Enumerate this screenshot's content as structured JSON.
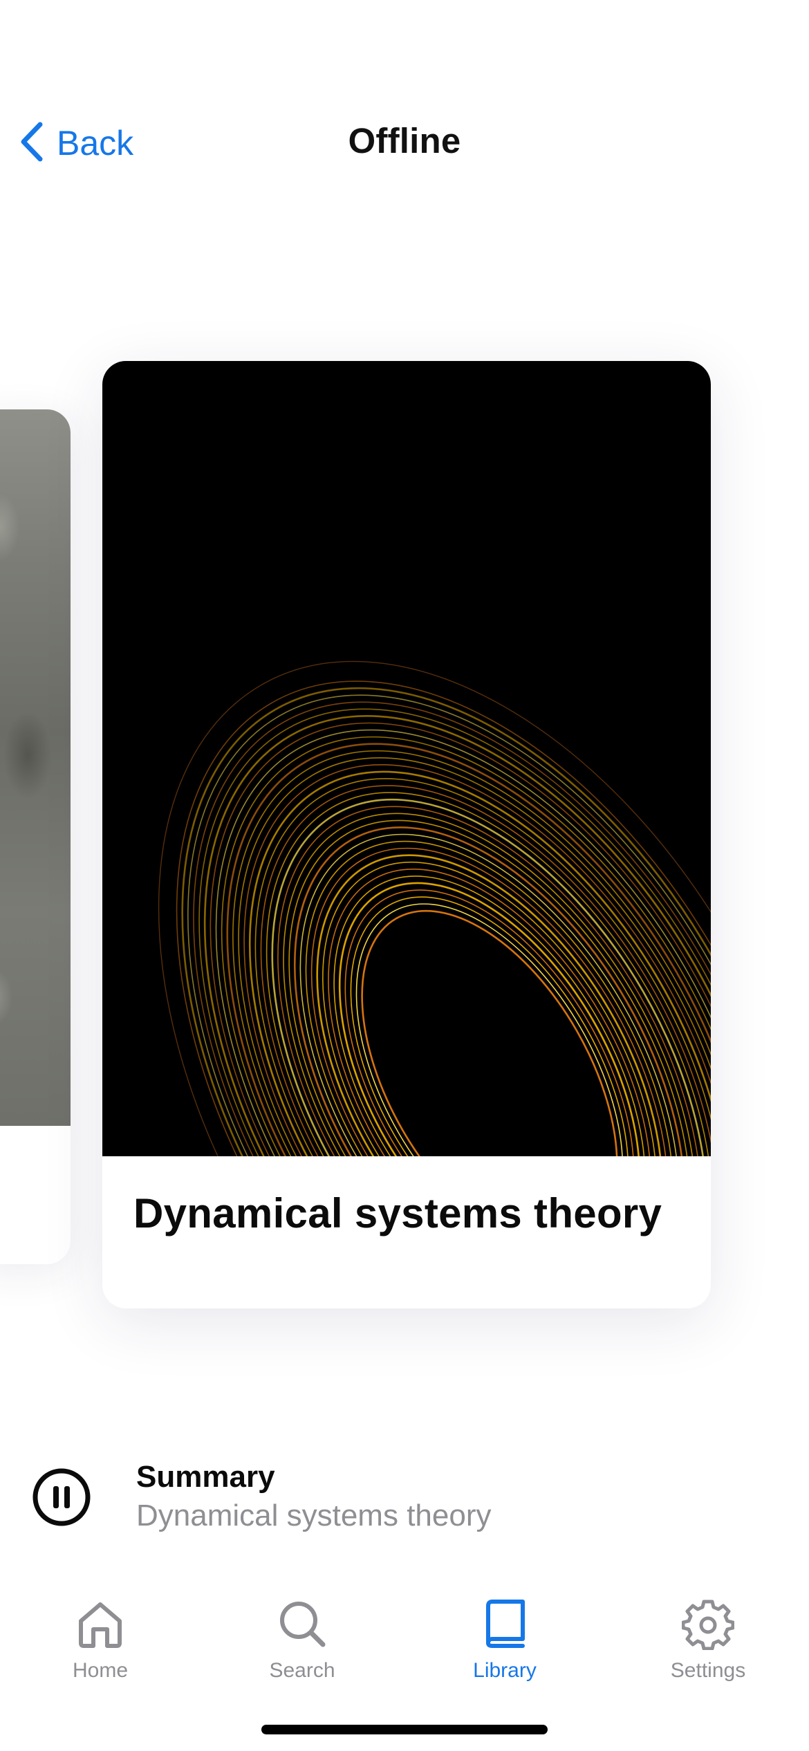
{
  "header": {
    "back_label": "Back",
    "title": "Offline"
  },
  "carousel": {
    "main_card": {
      "title": "Dynamical systems theory",
      "cover_icon": "orbit-trajectories-artwork"
    },
    "side_card": {
      "cover_icon": "grayscale-photo"
    }
  },
  "player": {
    "state": "playing",
    "title": "Summary",
    "subtitle": "Dynamical systems theory",
    "icon": "pause-icon"
  },
  "tabs": [
    {
      "label": "Home",
      "icon": "home-icon",
      "active": false
    },
    {
      "label": "Search",
      "icon": "search-icon",
      "active": false
    },
    {
      "label": "Library",
      "icon": "book-icon",
      "active": true
    },
    {
      "label": "Settings",
      "icon": "gear-icon",
      "active": false
    }
  ],
  "colors": {
    "accent": "#1677e8",
    "inactive": "#8e8e93",
    "text": "#0b0b0b",
    "cover_bg": "#000000",
    "orbit_gold": "#f4b400",
    "orbit_orange": "#e07a10"
  }
}
